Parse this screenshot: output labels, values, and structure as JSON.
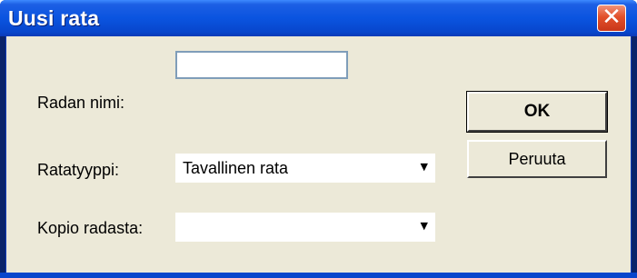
{
  "window": {
    "title": "Uusi rata",
    "close_glyph": "✕"
  },
  "form": {
    "course_name_label": "Radan nimi:",
    "course_name_value": "",
    "course_type_label": "Ratatyyppi:",
    "course_type_value": "Tavallinen rata",
    "copy_from_label": "Kopio radasta:",
    "copy_from_value": ""
  },
  "buttons": {
    "ok_label": "OK",
    "cancel_label": "Peruuta"
  },
  "icons": {
    "dropdown_arrow": "▼"
  },
  "colors": {
    "titlebar": "#0a54e0",
    "close_button": "#e2502a",
    "dialog_background": "#ece9d8"
  }
}
